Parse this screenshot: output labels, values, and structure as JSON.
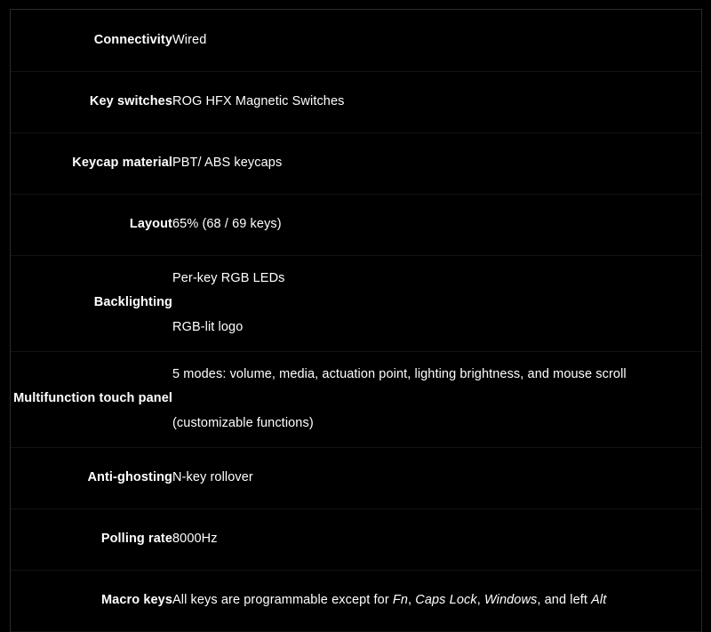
{
  "table": {
    "name": "product-specifications",
    "rows": [
      {
        "label": "Connectivity",
        "lines": [
          "Wired"
        ]
      },
      {
        "label": "Key switches",
        "lines": [
          "ROG HFX Magnetic Switches"
        ]
      },
      {
        "label": "Keycap material",
        "lines": [
          "PBT/ ABS keycaps"
        ]
      },
      {
        "label": "Layout",
        "lines": [
          "65% (68 / 69 keys)"
        ]
      },
      {
        "label": "Backlighting",
        "lines": [
          "Per-key RGB LEDs",
          "RGB-lit logo"
        ]
      },
      {
        "label": "Multifunction touch panel",
        "lines": [
          "5 modes: volume, media, actuation point, lighting brightness, and mouse scroll",
          "(customizable functions)"
        ]
      },
      {
        "label": "Anti-ghosting",
        "lines": [
          "N-key rollover"
        ]
      },
      {
        "label": "Polling rate",
        "lines": [
          "8000Hz"
        ]
      },
      {
        "label": "Macro keys",
        "lines": [
          "All keys are programmable except for Fn, Caps Lock, Windows, and left Alt"
        ],
        "rich": [
          [
            {
              "text": "All keys are programmable except for ",
              "italic": false
            },
            {
              "text": "Fn",
              "italic": true
            },
            {
              "text": ", ",
              "italic": false
            },
            {
              "text": "Caps Lock",
              "italic": true
            },
            {
              "text": ", ",
              "italic": false
            },
            {
              "text": "Windows",
              "italic": true
            },
            {
              "text": ", and left ",
              "italic": false
            },
            {
              "text": "Alt",
              "italic": true
            }
          ]
        ]
      }
    ]
  },
  "colors": {
    "background": "#000000",
    "text": "#ffffff",
    "border": "#2b2b2b",
    "row_divider": "#121212"
  }
}
